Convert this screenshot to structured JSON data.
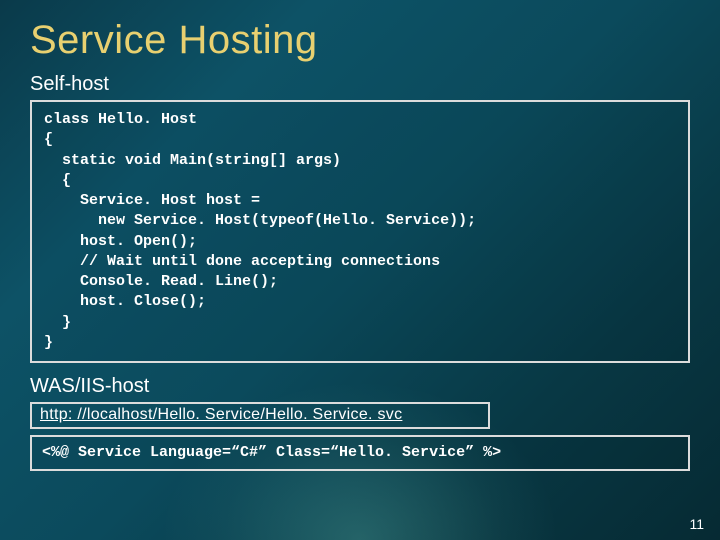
{
  "title": "Service Hosting",
  "sections": {
    "selfhost": {
      "label": "Self-host",
      "code": "class Hello. Host\n{\n  static void Main(string[] args)\n  {\n    Service. Host host =\n      new Service. Host(typeof(Hello. Service));\n    host. Open();\n    // Wait until done accepting connections\n    Console. Read. Line();\n    host. Close();\n  }\n}"
    },
    "washost": {
      "label": "WAS/IIS-host",
      "url": "http: //localhost/Hello. Service/Hello. Service. svc",
      "directive": "<%@ Service Language=“C#” Class=“Hello. Service” %>"
    }
  },
  "page_number": "11"
}
